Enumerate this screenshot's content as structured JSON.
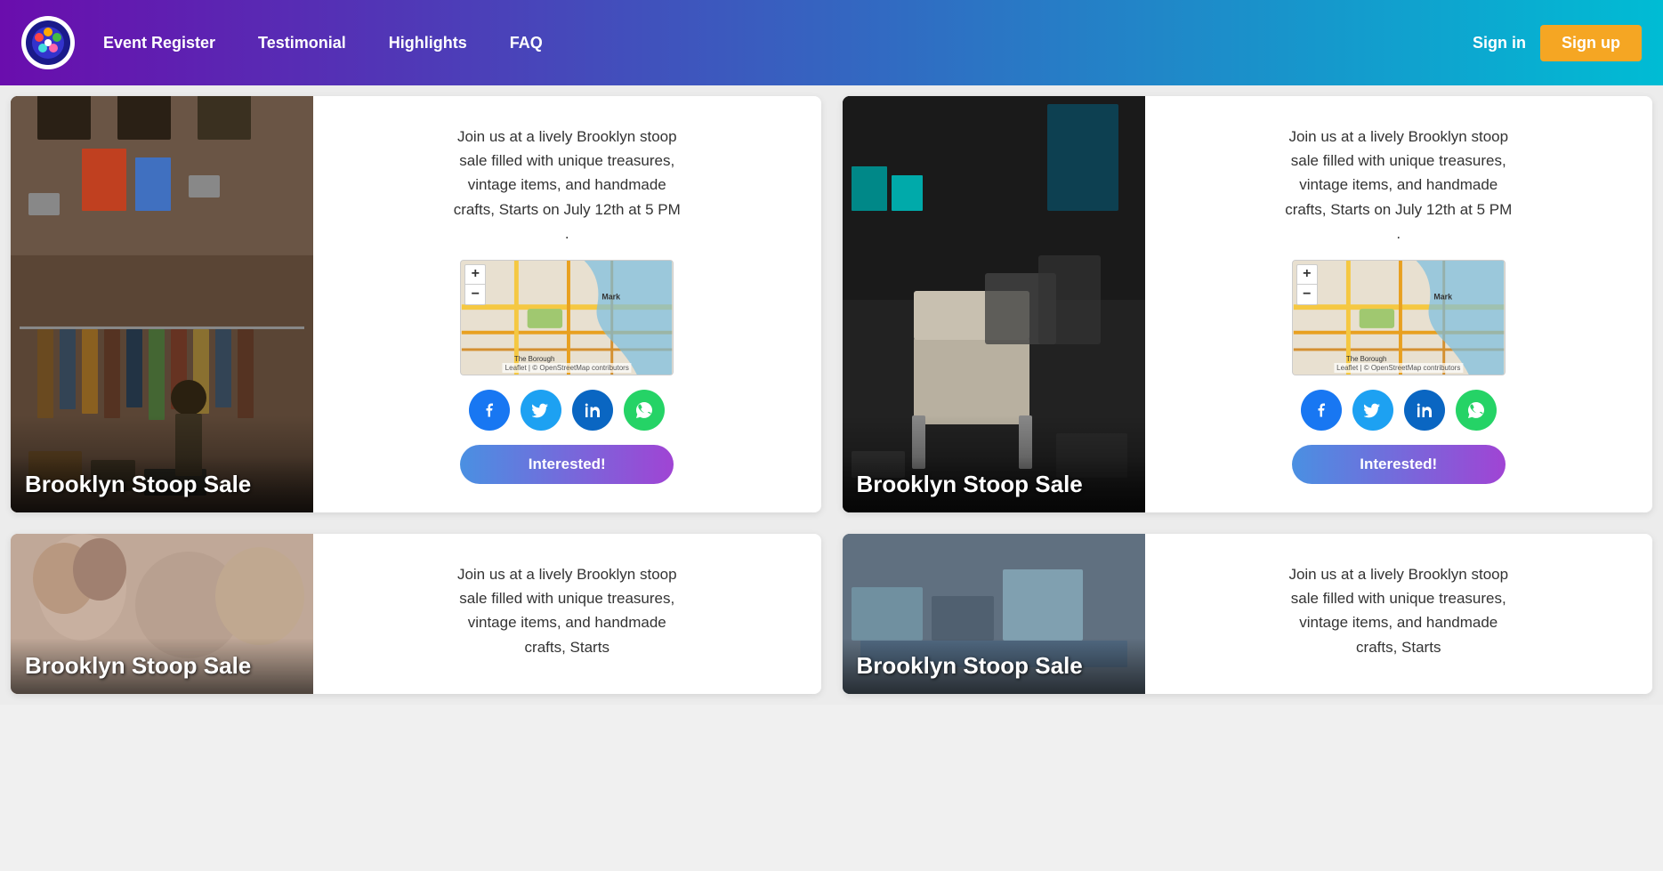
{
  "nav": {
    "links": [
      {
        "label": "Event Register",
        "id": "event-register"
      },
      {
        "label": "Testimonial",
        "id": "testimonial"
      },
      {
        "label": "Highlights",
        "id": "highlights"
      },
      {
        "label": "FAQ",
        "id": "faq"
      }
    ],
    "signin_label": "Sign in",
    "signup_label": "Sign up"
  },
  "events": [
    {
      "id": "event-1",
      "title": "Brooklyn Stoop Sale",
      "description": "Join us at a lively Brooklyn stoop sale filled with unique treasures, vintage items, and handmade crafts, Starts on July 12th at 5 PM .",
      "interested_label": "Interested!",
      "image_type": "stoop1",
      "map": {
        "zoom_in": "+",
        "zoom_out": "−",
        "label_mark": "Mark",
        "label_borough": "The Borough",
        "attribution": "Leaflet | © OpenStreetMap contributors"
      },
      "social": [
        {
          "type": "facebook",
          "icon": "f"
        },
        {
          "type": "twitter",
          "icon": "t"
        },
        {
          "type": "linkedin",
          "icon": "in"
        },
        {
          "type": "whatsapp",
          "icon": "w"
        }
      ]
    },
    {
      "id": "event-2",
      "title": "Brooklyn Stoop Sale",
      "description": "Join us at a lively Brooklyn stoop sale filled with unique treasures, vintage items, and handmade crafts, Starts on July 12th at 5 PM .",
      "interested_label": "Interested!",
      "image_type": "stoop2",
      "map": {
        "zoom_in": "+",
        "zoom_out": "−",
        "label_mark": "Mark",
        "label_borough": "The Borough",
        "attribution": "Leaflet | © OpenStreetMap contributors"
      },
      "social": [
        {
          "type": "facebook",
          "icon": "f"
        },
        {
          "type": "twitter",
          "icon": "t"
        },
        {
          "type": "linkedin",
          "icon": "in"
        },
        {
          "type": "whatsapp",
          "icon": "w"
        }
      ]
    }
  ],
  "events_bottom": [
    {
      "id": "event-3",
      "title": "Brooklyn Stoop Sale",
      "description": "Join us at a lively Brooklyn stoop sale filled with unique treasures, vintage items, and handmade crafts, Starts",
      "image_type": "stoop3"
    },
    {
      "id": "event-4",
      "title": "Brooklyn Stoop Sale",
      "description": "Join us at a lively Brooklyn stoop sale filled with unique treasures, vintage items, and handmade crafts, Starts",
      "image_type": "stoop4"
    }
  ]
}
